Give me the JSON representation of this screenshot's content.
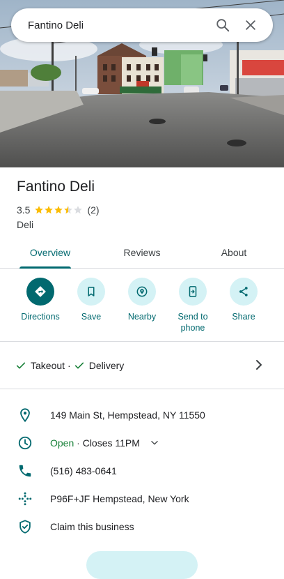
{
  "search": {
    "query": "Fantino Deli",
    "search_icon": "search-icon",
    "close_icon": "close-icon"
  },
  "place": {
    "name": "Fantino Deli",
    "rating": "3.5",
    "rating_value": 3.5,
    "reviews_count": "(2)",
    "category": "Deli"
  },
  "tabs": [
    {
      "label": "Overview",
      "active": true
    },
    {
      "label": "Reviews",
      "active": false
    },
    {
      "label": "About",
      "active": false
    }
  ],
  "actions": [
    {
      "label": "Directions",
      "icon": "directions-icon"
    },
    {
      "label": "Save",
      "icon": "bookmark-icon"
    },
    {
      "label": "Nearby",
      "icon": "nearby-icon"
    },
    {
      "label": "Send to phone",
      "icon": "send-to-phone-icon"
    },
    {
      "label": "Share",
      "icon": "share-icon"
    }
  ],
  "services": {
    "takeout": "Takeout",
    "separator": "·",
    "delivery": "Delivery"
  },
  "info": {
    "address": "149 Main St, Hempstead, NY 11550",
    "open_status": "Open",
    "hours_separator": "·",
    "closes": "Closes 11PM",
    "phone": "(516) 483-0641",
    "plus_code": "P96F+JF Hempstead, New York",
    "claim": "Claim this business"
  },
  "colors": {
    "accent": "#01696f",
    "accent_light": "#d4f2f5",
    "open": "#188038",
    "star": "#fbbc04"
  }
}
